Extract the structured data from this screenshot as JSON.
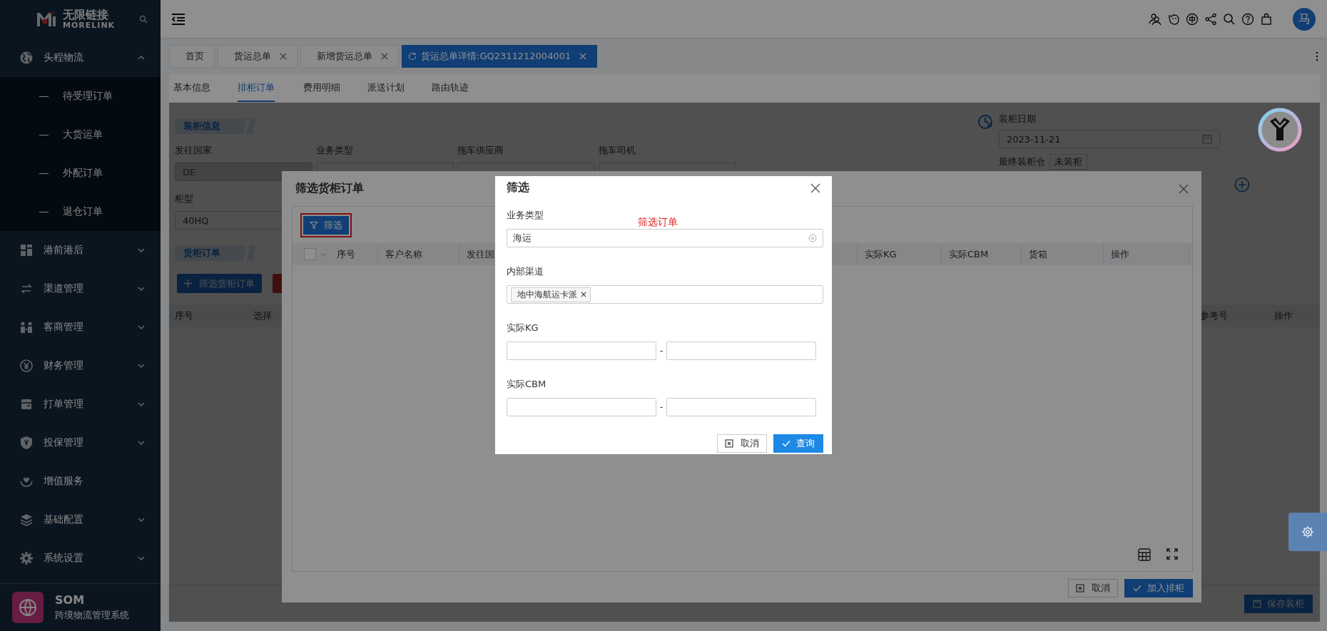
{
  "sidebar": {
    "logo_title": "无限链接",
    "logo_subtitle": "MORELINK",
    "menu": [
      {
        "label": "头程物流",
        "expandable": true,
        "expanded": true,
        "children": [
          {
            "label": "待受理订单"
          },
          {
            "label": "大货运单"
          },
          {
            "label": "外配订单"
          },
          {
            "label": "退仓订单"
          }
        ]
      },
      {
        "label": "港前港后",
        "expandable": true,
        "expanded": false
      },
      {
        "label": "渠道管理",
        "expandable": true,
        "expanded": false
      },
      {
        "label": "客商管理",
        "expandable": true,
        "expanded": false
      },
      {
        "label": "财务管理",
        "expandable": true,
        "expanded": false
      },
      {
        "label": "打单管理",
        "expandable": true,
        "expanded": false
      },
      {
        "label": "投保管理",
        "expandable": true,
        "expanded": false
      },
      {
        "label": "增值服务",
        "expandable": false
      },
      {
        "label": "基础配置",
        "expandable": true,
        "expanded": false
      },
      {
        "label": "系统设置",
        "expandable": true,
        "expanded": false
      }
    ],
    "footer": {
      "title": "SOM",
      "subtitle": "跨境物流管理系统"
    }
  },
  "header": {
    "avatar_text": "马"
  },
  "tabs": [
    {
      "label": "首页",
      "closable": false,
      "selected": false
    },
    {
      "label": "货运总单",
      "closable": true,
      "selected": false
    },
    {
      "label": "新增货运总单",
      "closable": true,
      "selected": false
    },
    {
      "label": "货运总单详情:GQ2311212004001",
      "closable": true,
      "selected": true
    }
  ],
  "sub_tabs": [
    {
      "label": "基本信息",
      "selected": false
    },
    {
      "label": "排柜订单",
      "selected": true
    },
    {
      "label": "费用明细",
      "selected": false
    },
    {
      "label": "派送计划",
      "selected": false
    },
    {
      "label": "路由轨迹",
      "selected": false
    }
  ],
  "page": {
    "section_1": "装柜信息",
    "fields": [
      {
        "label": "发往国家",
        "value": "DE",
        "disabled": true
      },
      {
        "label": "业务类型",
        "disabled": false
      },
      {
        "label": "拖车供应商",
        "disabled": false
      },
      {
        "label": "拖车司机",
        "disabled": false
      }
    ],
    "container_type": {
      "label": "柜型",
      "value": "40HQ"
    },
    "loading_date": {
      "label": "装柜日期",
      "value": "2023-11-21"
    },
    "final_warehouse": {
      "label": "最终装柜仓",
      "tag": "未装柜"
    },
    "section_2": "货柜订单",
    "add_button": "筛选货柜订单",
    "table_columns_left": [
      "序号",
      "选择"
    ],
    "table_columns_right": [
      "参考号",
      "操作"
    ],
    "save_button": "保存装柜"
  },
  "select_dialog": {
    "title": "筛选货柜订单",
    "filter_button": "筛选",
    "filter_highlighted": true,
    "select_all_checked": false,
    "columns": [
      "序号",
      "客户名称",
      "发往国",
      "实际KG",
      "实际CBM",
      "货箱",
      "操作"
    ],
    "buttons": [
      {
        "label": "取消",
        "kind": "cancel"
      },
      {
        "label": "加入排柜",
        "kind": "confirm"
      }
    ]
  },
  "filter_dialog": {
    "title": "筛选",
    "note": "筛选订单",
    "fields": [
      {
        "kind": "select",
        "label": "业务类型",
        "value": "海运"
      },
      {
        "kind": "tags",
        "label": "内部渠道",
        "tags": [
          "地中海航运卡派"
        ]
      },
      {
        "kind": "range",
        "label": "实际KG",
        "separator": "-"
      },
      {
        "kind": "range",
        "label": "实际CBM",
        "separator": "-"
      }
    ],
    "buttons": [
      {
        "label": "取消",
        "kind": "cancel"
      },
      {
        "label": "查询",
        "kind": "confirm"
      }
    ]
  }
}
